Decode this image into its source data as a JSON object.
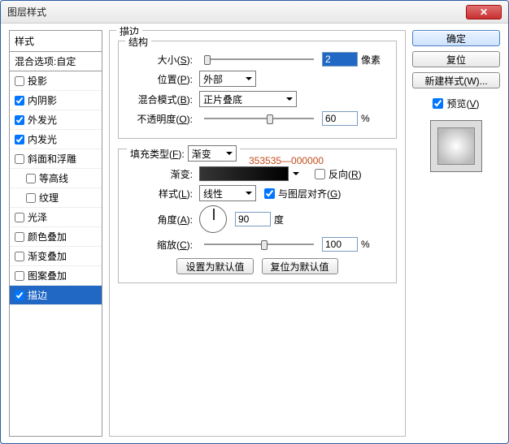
{
  "window": {
    "title": "图层样式"
  },
  "styles": {
    "header": "样式",
    "blend_row": "混合选项:自定",
    "items": [
      {
        "label": "投影",
        "checked": false,
        "indent": false
      },
      {
        "label": "内阴影",
        "checked": true,
        "indent": false
      },
      {
        "label": "外发光",
        "checked": true,
        "indent": false
      },
      {
        "label": "内发光",
        "checked": true,
        "indent": false
      },
      {
        "label": "斜面和浮雕",
        "checked": false,
        "indent": false
      },
      {
        "label": "等高线",
        "checked": false,
        "indent": true
      },
      {
        "label": "纹理",
        "checked": false,
        "indent": true
      },
      {
        "label": "光泽",
        "checked": false,
        "indent": false
      },
      {
        "label": "颜色叠加",
        "checked": false,
        "indent": false
      },
      {
        "label": "渐变叠加",
        "checked": false,
        "indent": false
      },
      {
        "label": "图案叠加",
        "checked": false,
        "indent": false
      },
      {
        "label": "描边",
        "checked": true,
        "indent": false,
        "selected": true
      }
    ]
  },
  "stroke": {
    "title": "描边",
    "structure": {
      "title": "结构",
      "size_label": "大小(S):",
      "size_value": "2",
      "size_unit": "像素",
      "position_label": "位置(P):",
      "position_value": "外部",
      "blendmode_label": "混合模式(B):",
      "blendmode_value": "正片叠底",
      "opacity_label": "不透明度(O):",
      "opacity_value": "60",
      "opacity_unit": "%"
    },
    "fill": {
      "type_label": "填充类型(F):",
      "type_value": "渐变",
      "grad_label": "渐变:",
      "annotation": "353535—000000",
      "reverse_label": "反向(R)",
      "reverse_checked": false,
      "style_label": "样式(L):",
      "style_value": "线性",
      "align_label": "与图层对齐(G)",
      "align_checked": true,
      "angle_label": "角度(A):",
      "angle_value": "90",
      "angle_unit": "度",
      "scale_label": "缩放(C):",
      "scale_value": "100",
      "scale_unit": "%"
    },
    "buttons": {
      "make_default": "设置为默认值",
      "reset_default": "复位为默认值"
    }
  },
  "right": {
    "ok": "确定",
    "cancel": "复位",
    "new_style": "新建样式(W)...",
    "preview_label": "预览(V)",
    "preview_checked": true
  }
}
